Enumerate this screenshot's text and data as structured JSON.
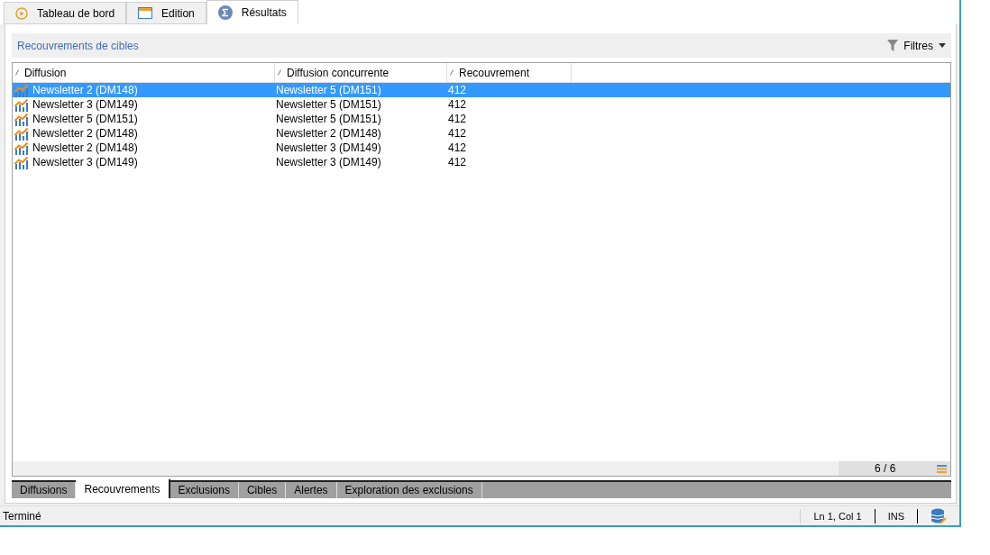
{
  "tabs": [
    {
      "label": "Tableau de bord",
      "selected": false
    },
    {
      "label": "Edition",
      "selected": false
    },
    {
      "label": "Résultats",
      "selected": true
    }
  ],
  "panel": {
    "title": "Recouvrements de cibles",
    "filter_button": "Filtres"
  },
  "table": {
    "columns": [
      "Diffusion",
      "Diffusion concurrente",
      "Recouvrement"
    ],
    "rows": [
      {
        "cells": [
          "Newsletter 2 (DM148)",
          "Newsletter 5 (DM151)",
          "412"
        ],
        "selected": true
      },
      {
        "cells": [
          "Newsletter 3 (DM149)",
          "Newsletter 5 (DM151)",
          "412"
        ],
        "selected": false
      },
      {
        "cells": [
          "Newsletter 5 (DM151)",
          "Newsletter 5 (DM151)",
          "412"
        ],
        "selected": false
      },
      {
        "cells": [
          "Newsletter 2 (DM148)",
          "Newsletter 2 (DM148)",
          "412"
        ],
        "selected": false
      },
      {
        "cells": [
          "Newsletter 2 (DM148)",
          "Newsletter 3 (DM149)",
          "412"
        ],
        "selected": false
      },
      {
        "cells": [
          "Newsletter 3 (DM149)",
          "Newsletter 3 (DM149)",
          "412"
        ],
        "selected": false
      }
    ],
    "count": "6 / 6"
  },
  "bottom_tabs": [
    {
      "label": "Diffusions",
      "selected": false
    },
    {
      "label": "Recouvrements",
      "selected": true
    },
    {
      "label": "Exclusions",
      "selected": false
    },
    {
      "label": "Cibles",
      "selected": false
    },
    {
      "label": "Alertes",
      "selected": false
    },
    {
      "label": "Exploration des exclusions",
      "selected": false
    }
  ],
  "status_bar": {
    "message": "Terminé",
    "position": "Ln 1, Col 1",
    "mode": "INS"
  }
}
